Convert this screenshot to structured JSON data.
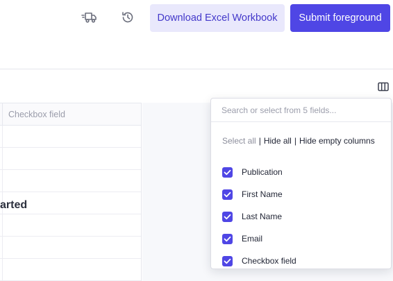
{
  "toolbar": {
    "truck_icon": "delivery-truck-icon",
    "history_icon": "history-icon",
    "download_label": "Download Excel Workbook",
    "submit_label": "Submit foreground"
  },
  "table": {
    "column_header": "Checkbox field",
    "group_label": "arted",
    "row_count": 7
  },
  "columns_panel": {
    "toggle_icon": "columns-icon",
    "search_placeholder": "Search or select from 5 fields...",
    "actions": {
      "select_all": "Select all",
      "separator": "|",
      "hide_all": "Hide all",
      "hide_empty": "Hide empty columns"
    },
    "fields": [
      {
        "label": "Publication",
        "checked": true
      },
      {
        "label": "First Name",
        "checked": true
      },
      {
        "label": "Last Name",
        "checked": true
      },
      {
        "label": "Email",
        "checked": true
      },
      {
        "label": "Checkbox field",
        "checked": true
      }
    ]
  },
  "colors": {
    "accent": "#4f46e5",
    "accent_soft": "#e9e8fc",
    "accent_text": "#4338ca"
  }
}
